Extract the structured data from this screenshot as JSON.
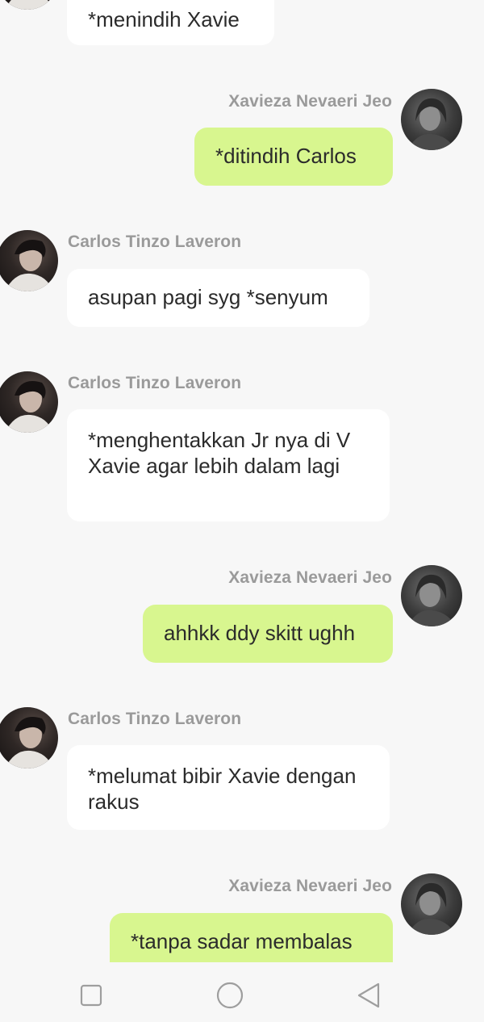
{
  "messages": [
    {
      "sender": "Carlos Tinzo Laveron",
      "side": "in",
      "text": "*menindih Xavie",
      "show_name": false
    },
    {
      "sender": "Xavieza Nevaeri Jeo",
      "side": "out",
      "text": "*ditindih Carlos",
      "show_name": true
    },
    {
      "sender": "Carlos Tinzo Laveron",
      "side": "in",
      "text": "asupan pagi syg *senyum",
      "show_name": true
    },
    {
      "sender": "Carlos Tinzo Laveron",
      "side": "in",
      "text": "*menghentakkan Jr nya di V Xavie agar lebih dalam lagi",
      "show_name": true
    },
    {
      "sender": "Xavieza Nevaeri Jeo",
      "side": "out",
      "text": "ahhkk ddy skitt ughh",
      "show_name": true
    },
    {
      "sender": "Carlos Tinzo Laveron",
      "side": "in",
      "text": "*melumat bibir Xavie dengan rakus",
      "show_name": true
    },
    {
      "sender": "Xavieza Nevaeri Jeo",
      "side": "out",
      "text": "*tanpa sadar membalas",
      "show_name": true
    }
  ],
  "navbar": {
    "recents_icon": "square-icon",
    "home_icon": "circle-icon",
    "back_icon": "triangle-back-icon"
  },
  "colors": {
    "background": "#f7f7f7",
    "incoming_bubble": "#ffffff",
    "outgoing_bubble": "#d8f68f",
    "sender_name": "#9a9a9a",
    "text": "#2b2b2b"
  }
}
